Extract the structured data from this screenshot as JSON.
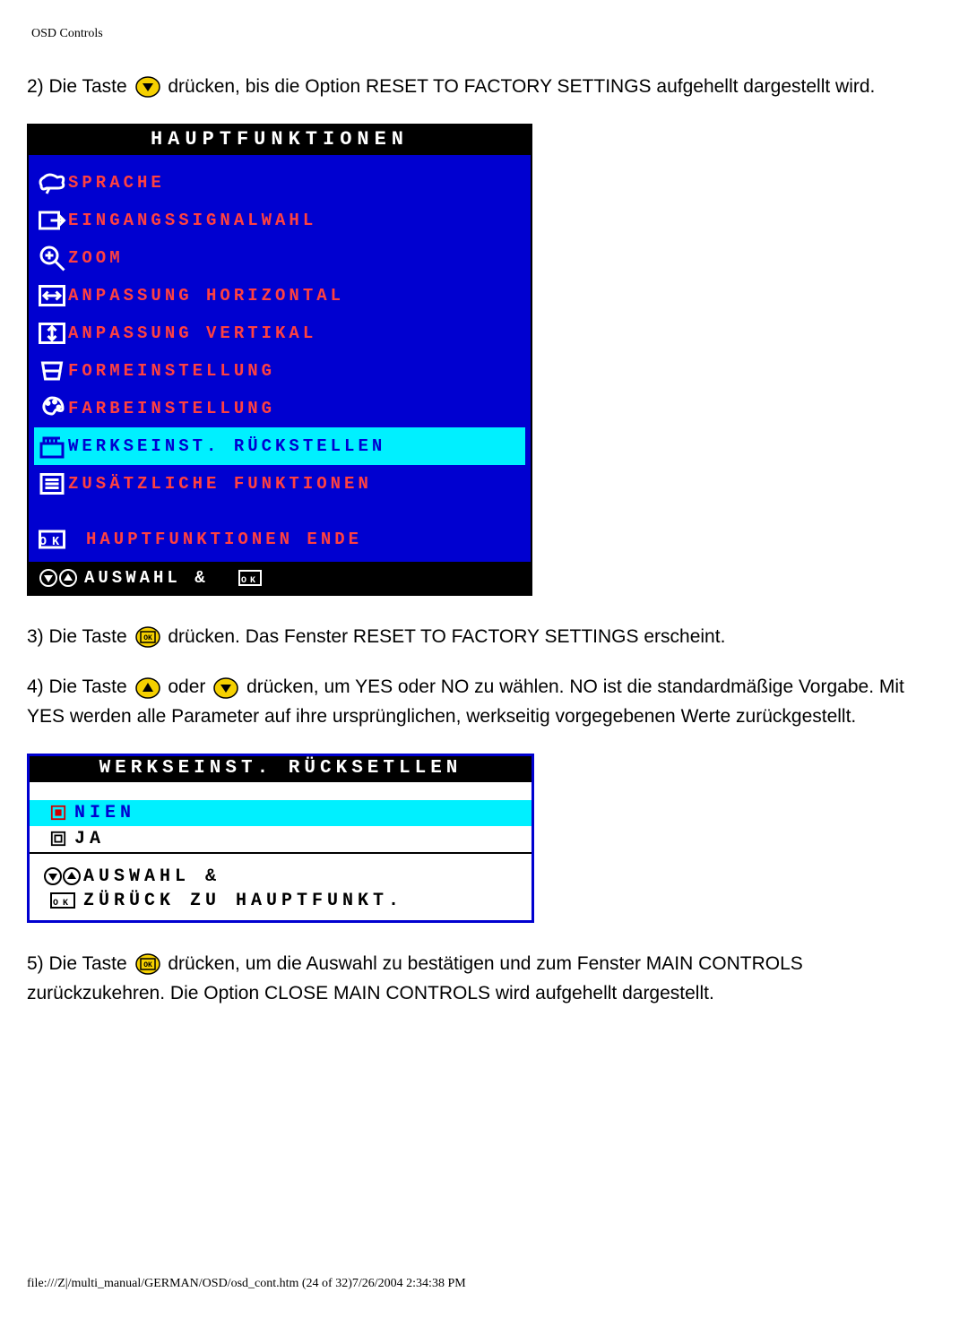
{
  "page_header": "OSD Controls",
  "step2": {
    "before": "2) Die Taste ",
    "after": " drücken, bis die Option RESET TO FACTORY SETTINGS aufgehellt dargestellt wird."
  },
  "osd": {
    "title": "HAUPTFUNKTIONEN",
    "items": [
      {
        "label": "SPRACHE",
        "icon": "language-icon",
        "highlight": false
      },
      {
        "label": "EINGANGSSIGNALWAHL",
        "icon": "input-select-icon",
        "highlight": false
      },
      {
        "label": "ZOOM",
        "icon": "zoom-icon",
        "highlight": false
      },
      {
        "label": "ANPASSUNG HORIZONTAL",
        "icon": "horizontal-adjust-icon",
        "highlight": false
      },
      {
        "label": "ANPASSUNG VERTIKAL",
        "icon": "vertical-adjust-icon",
        "highlight": false
      },
      {
        "label": "FORMEINSTELLUNG",
        "icon": "shape-adjust-icon",
        "highlight": false
      },
      {
        "label": "FARBEINSTELLUNG",
        "icon": "color-adjust-icon",
        "highlight": false
      },
      {
        "label": "WERKSEINST. RÜCKSTELLEN",
        "icon": "factory-reset-icon",
        "highlight": true
      },
      {
        "label": "ZUSÄTZLICHE FUNKTIONEN",
        "icon": "extra-features-icon",
        "highlight": false
      }
    ],
    "exit_label": "HAUPTFUNKTIONEN ENDE",
    "footer_label": "AUSWAHL &"
  },
  "step3": {
    "before": "3) Die Taste ",
    "after": " drücken. Das Fenster RESET TO FACTORY SETTINGS erscheint."
  },
  "step4": {
    "before": "4) Die Taste ",
    "mid": " oder ",
    "after": " drücken, um YES oder NO zu wählen. NO ist die standardmäßige Vorgabe. Mit YES werden alle Parameter auf ihre ursprünglichen, werkseitig vorgegebenen Werte zurückgestellt."
  },
  "sub": {
    "title": "WERKSEINST. RÜCKSETLLEN",
    "options": [
      {
        "label": "NIEN",
        "selected": true
      },
      {
        "label": "JA",
        "selected": false
      }
    ],
    "hint1": "AUSWAHL &",
    "hint2": "ZÜRÜCK ZU HAUPTFUNKT."
  },
  "step5": {
    "before": "5) Die Taste ",
    "after": " drücken, um die Auswahl zu bestätigen und zum Fenster MAIN CONTROLS zurückzukehren. Die Option CLOSE MAIN CONTROLS wird aufgehellt dargestellt."
  },
  "page_footer": "file:///Z|/multi_manual/GERMAN/OSD/osd_cont.htm (24 of 32)7/26/2004 2:34:38 PM"
}
